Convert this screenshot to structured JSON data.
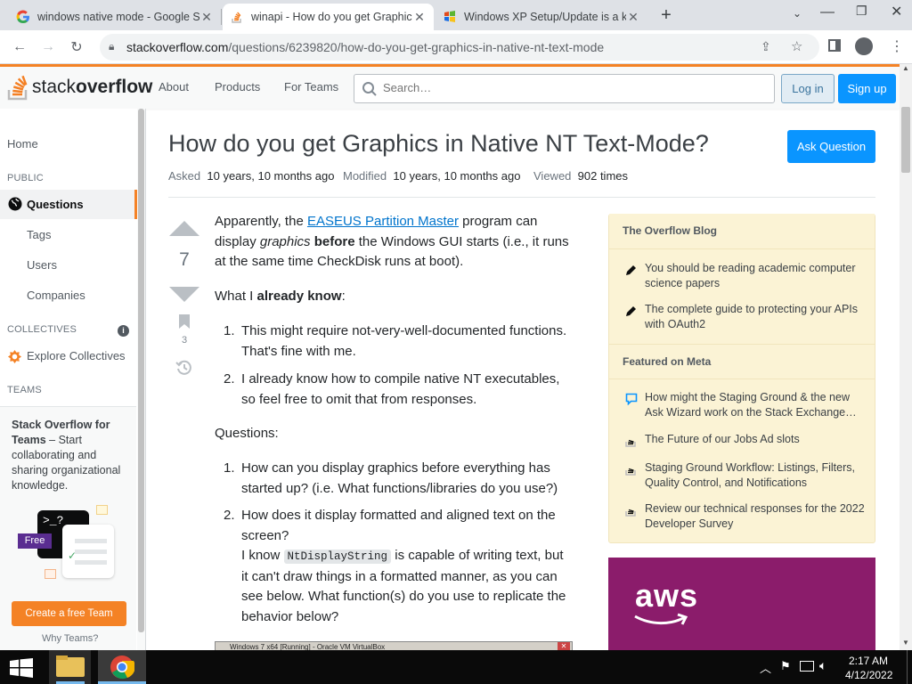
{
  "browser": {
    "tabs": [
      {
        "title": "windows native mode - Google S",
        "icon": "google-icon",
        "active": false
      },
      {
        "title": "winapi - How do you get Graphic",
        "icon": "stackoverflow-icon",
        "active": true
      },
      {
        "title": "Windows XP Setup/Update is a k",
        "icon": "winxp-icon",
        "active": false
      }
    ],
    "url_host": "stackoverflow.com",
    "url_path": "/questions/6239820/how-do-you-get-graphics-in-native-nt-text-mode"
  },
  "so_header": {
    "logo_text_a": "stack",
    "logo_text_b": "overflow",
    "nav": [
      "About",
      "Products",
      "For Teams"
    ],
    "search_placeholder": "Search…",
    "login": "Log in",
    "signup": "Sign up"
  },
  "sidebar": {
    "home": "Home",
    "public": "PUBLIC",
    "questions": "Questions",
    "tags": "Tags",
    "users": "Users",
    "companies": "Companies",
    "collectives": "COLLECTIVES",
    "explore": "Explore Collectives",
    "teams": "TEAMS",
    "teams_title": "Stack Overflow for Teams",
    "teams_dash": " – Start collaborating and sharing organizational knowledge.",
    "free_badge": "Free",
    "prompt": ">_?",
    "create_team": "Create a free Team",
    "why_teams": "Why Teams?"
  },
  "question": {
    "title": "How do you get Graphics in Native NT Text-Mode?",
    "ask_button": "Ask Question",
    "asked_label": "Asked",
    "asked": "10 years, 10 months ago",
    "modified_label": "Modified",
    "modified": "10 years, 10 months ago",
    "viewed_label": "Viewed",
    "viewed": "902 times",
    "score": "7",
    "bookmarks": "3",
    "p1_a": "Apparently, the ",
    "p1_link": "EASEUS Partition Master",
    "p1_b": " program can display ",
    "p1_em": "graphics",
    "p1_c": " ",
    "p1_strong": "before",
    "p1_d": " the Windows GUI starts (i.e., it runs at the same time CheckDisk runs at boot).",
    "p2_a": "What I ",
    "p2_strong": "already know",
    "p2_b": ":",
    "known": [
      "This might require not-very-well-documented functions. That's fine with me.",
      "I already know how to compile native NT executables, so feel free to omit that from responses."
    ],
    "questions_label": "Questions:",
    "q1": "How can you display graphics before everything has started up? (i.e. What functions/libraries do you use?)",
    "q2_a": "How does it display formatted and aligned text on the screen?",
    "q2_b": "I know ",
    "q2_code": "NtDisplayString",
    "q2_c": " is capable of writing text, but it can't draw things in a formatted manner, as you can see below. What function(s) do you use to replicate the behavior below?",
    "screenshot_caption": "Windows 7 x64 [Running] - Oracle VM VirtualBox"
  },
  "right": {
    "blog_head": "The Overflow Blog",
    "blog": [
      "You should be reading academic computer science papers",
      "The complete guide to protecting your APIs with OAuth2"
    ],
    "meta_head": "Featured on Meta",
    "meta": [
      "How might the Staging Ground & the new Ask Wizard work on the Stack Exchange…",
      "The Future of our Jobs Ad slots",
      "Staging Ground Workflow: Listings, Filters, Quality Control, and Notifications",
      "Review our technical responses for the 2022 Developer Survey"
    ],
    "ad_text": "aws"
  },
  "taskbar": {
    "time": "2:17 AM",
    "date": "4/12/2022"
  }
}
